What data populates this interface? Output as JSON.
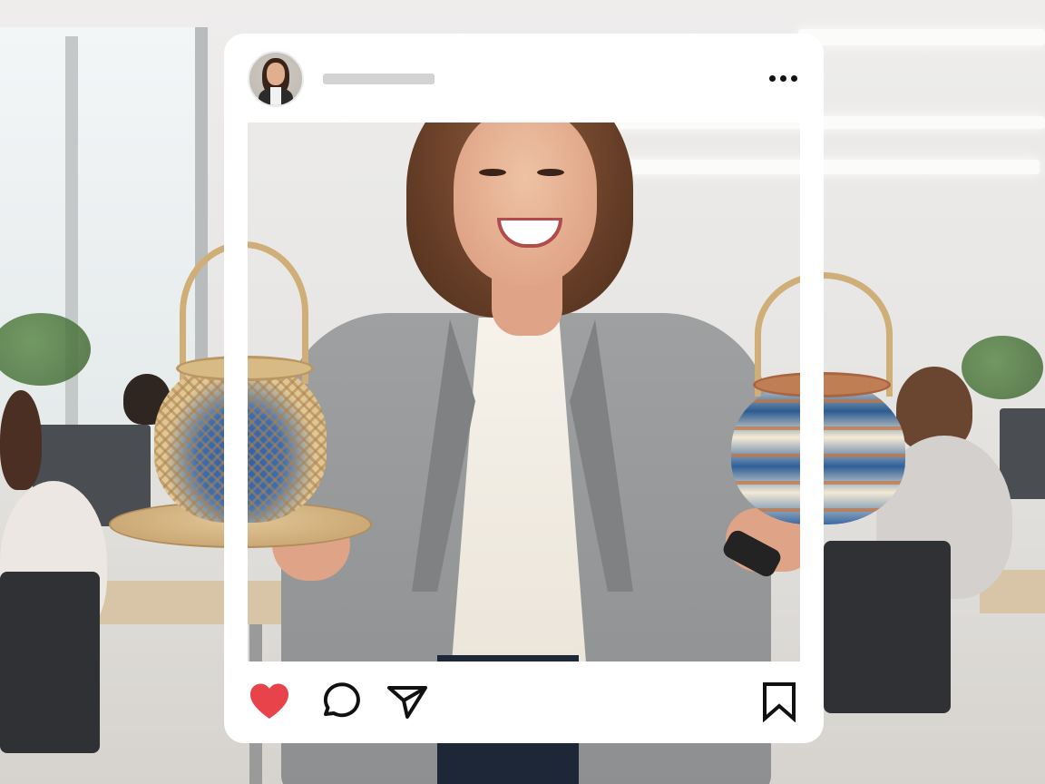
{
  "post": {
    "username": "",
    "colors": {
      "like": "#e8424b",
      "icon_stroke": "#111111",
      "card_bg": "#ffffff",
      "username_placeholder": "#d3d3d3"
    },
    "icons": {
      "avatar": "profile-photo",
      "more": "more-dots-icon",
      "like": "heart-icon",
      "comment": "comment-bubble-icon",
      "share": "paper-plane-icon",
      "save": "bookmark-icon"
    },
    "liked": true
  }
}
